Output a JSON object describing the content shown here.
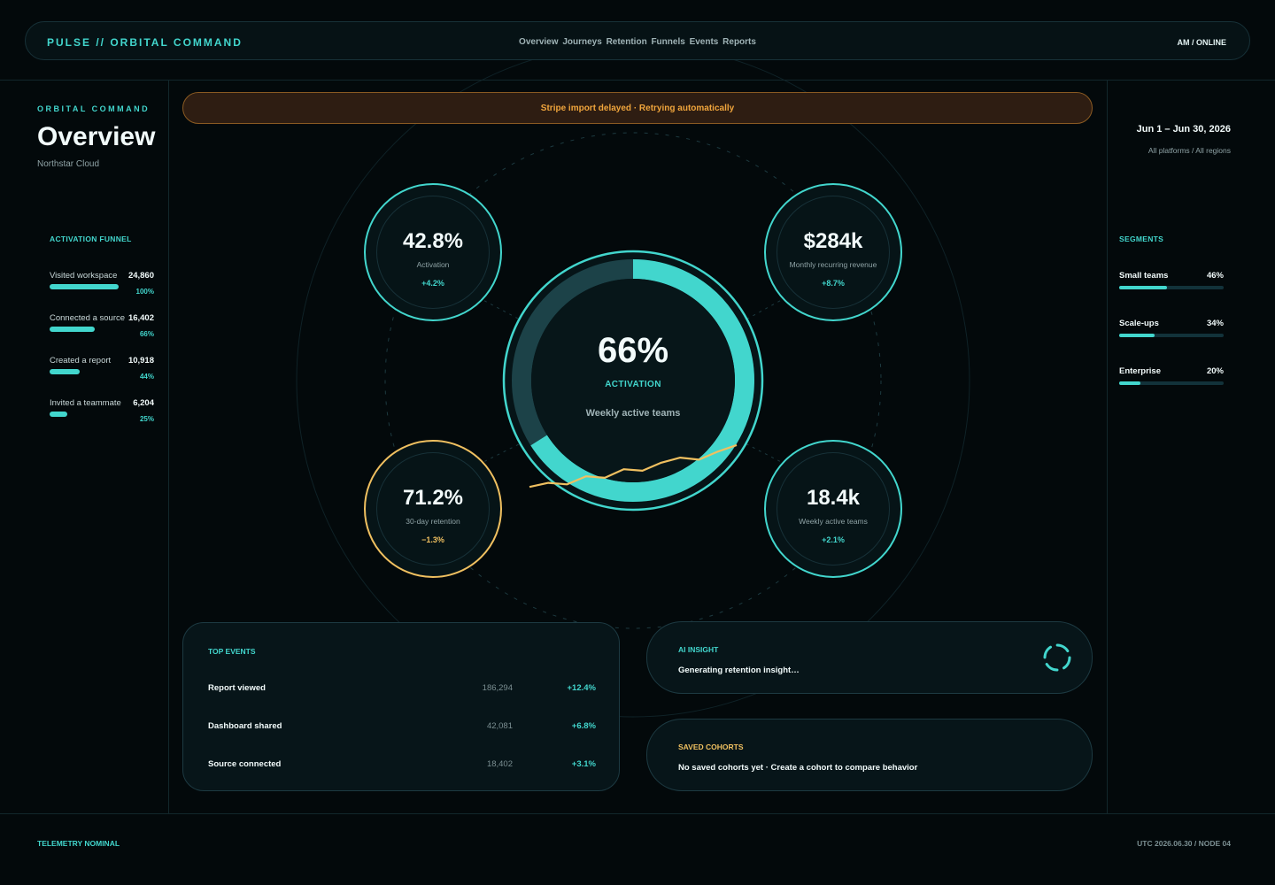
{
  "header": {
    "brand": "PULSE // ORBITAL COMMAND",
    "nav": [
      "Overview",
      "Journeys",
      "Retention",
      "Funnels",
      "Events",
      "Reports"
    ],
    "status": "AM / ONLINE"
  },
  "sidebar": {
    "eyebrow": "ORBITAL COMMAND",
    "title": "Overview",
    "workspace": "Northstar Cloud",
    "funnel_label": "ACTIVATION FUNNEL",
    "funnel": [
      {
        "name": "Visited workspace",
        "count": "24,860",
        "pct": "100%",
        "fraction": 1.0
      },
      {
        "name": "Connected a source",
        "count": "16,402",
        "pct": "66%",
        "fraction": 0.66
      },
      {
        "name": "Created a report",
        "count": "10,918",
        "pct": "44%",
        "fraction": 0.44
      },
      {
        "name": "Invited a teammate",
        "count": "6,204",
        "pct": "25%",
        "fraction": 0.25
      }
    ]
  },
  "alert": {
    "text": "Stripe import delayed · Retrying automatically"
  },
  "right_panel": {
    "date_range": "Jun 1 – Jun 30, 2026",
    "scope": "All platforms / All regions",
    "segments_label": "SEGMENTS",
    "segments": [
      {
        "name": "Small teams",
        "pct": "46%",
        "fraction": 0.46
      },
      {
        "name": "Scale-ups",
        "pct": "34%",
        "fraction": 0.34
      },
      {
        "name": "Enterprise",
        "pct": "20%",
        "fraction": 0.2
      }
    ]
  },
  "hub": {
    "value": "66%",
    "label": "ACTIVATION",
    "sublabel": "Weekly active teams",
    "progress": 0.66,
    "trend": [
      0.12,
      0.2,
      0.17,
      0.33,
      0.3,
      0.47,
      0.44,
      0.6,
      0.7,
      0.66,
      0.82,
      0.95
    ],
    "colors": {
      "accent": "#42d6cd",
      "trend": "#f0c060",
      "track": "#1c4248"
    }
  },
  "kpis": [
    {
      "value": "42.8%",
      "label": "Activation",
      "delta": "+4.2%",
      "tone": "accent"
    },
    {
      "value": "$284k",
      "label": "Monthly recurring revenue",
      "delta": "+8.7%",
      "tone": "accent"
    },
    {
      "value": "71.2%",
      "label": "30-day retention",
      "delta": "−1.3%",
      "tone": "warn"
    },
    {
      "value": "18.4k",
      "label": "Weekly active teams",
      "delta": "+2.1%",
      "tone": "accent"
    }
  ],
  "top_events": {
    "label": "TOP EVENTS",
    "rows": [
      {
        "name": "Report viewed",
        "count": "186,294",
        "delta": "+12.4%"
      },
      {
        "name": "Dashboard shared",
        "count": "42,081",
        "delta": "+6.8%"
      },
      {
        "name": "Source connected",
        "count": "18,402",
        "delta": "+3.1%"
      }
    ]
  },
  "ai_insight": {
    "label": "AI INSIGHT",
    "message": "Generating retention insight…",
    "icon": "spinner-icon"
  },
  "saved_cohorts": {
    "label": "SAVED COHORTS",
    "message": "No saved cohorts yet · Create a cohort to compare behavior",
    "label_color": "#f0c060"
  },
  "footer": {
    "left": "TELEMETRY NOMINAL",
    "right": "UTC 2026.06.30 / NODE 04"
  }
}
